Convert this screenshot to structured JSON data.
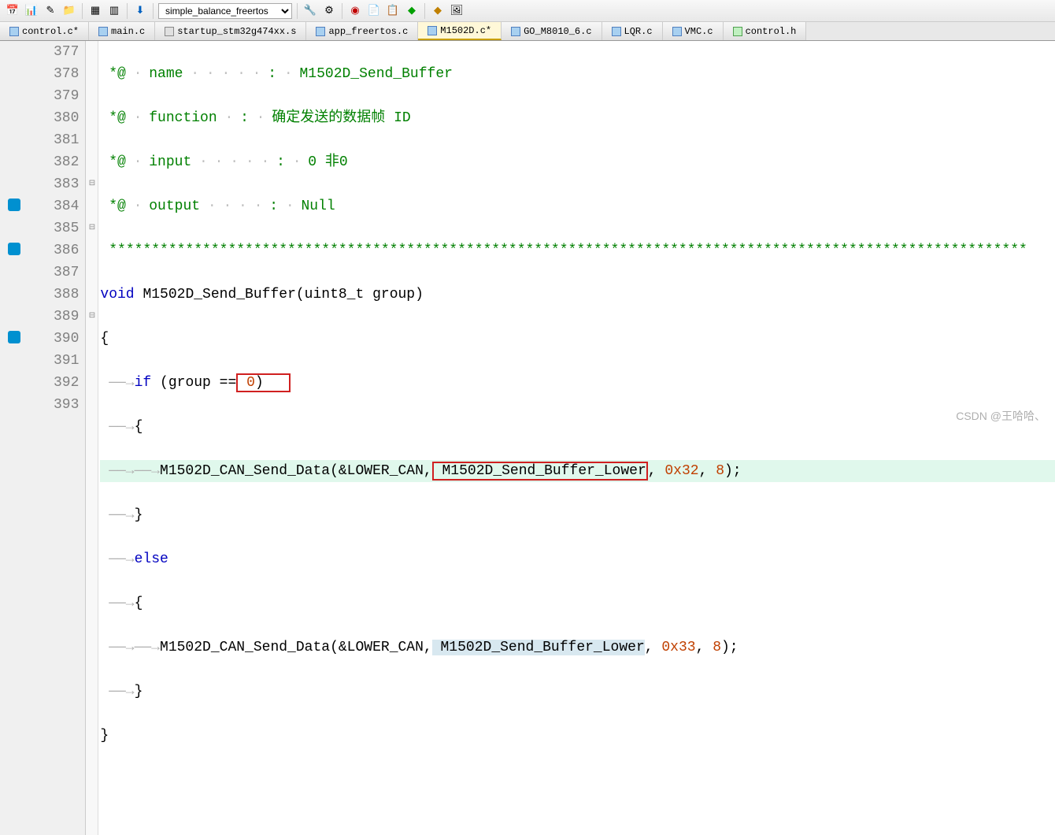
{
  "toolbar": {
    "combo_value": "simple_balance_freertos"
  },
  "tabs": [
    {
      "label": "control.c*",
      "type": "c",
      "active": false
    },
    {
      "label": "main.c",
      "type": "c",
      "active": false
    },
    {
      "label": "startup_stm32g474xx.s",
      "type": "s",
      "active": false
    },
    {
      "label": "app_freertos.c",
      "type": "c",
      "active": false
    },
    {
      "label": "M1502D.c*",
      "type": "c",
      "active": true
    },
    {
      "label": "GO_M8010_6.c",
      "type": "c",
      "active": false
    },
    {
      "label": "LQR.c",
      "type": "c",
      "active": false
    },
    {
      "label": "VMC.c",
      "type": "c",
      "active": false
    },
    {
      "label": "control.h",
      "type": "h",
      "active": false
    }
  ],
  "lines": {
    "start": 377,
    "end": 393
  },
  "code": {
    "c377": {
      "star": "*@",
      "key": "name",
      "val": "M1502D_Send_Buffer"
    },
    "c378": {
      "star": "*@",
      "key": "function",
      "val": "确定发送的数据帧 ID"
    },
    "c379": {
      "star": "*@",
      "key": "input",
      "val": "0 非0"
    },
    "c380": {
      "star": "*@",
      "key": "output",
      "val": "Null"
    },
    "c381": {
      "stars": "************************************************************************************************************"
    },
    "c382": {
      "kw": "void",
      "fn": "M1502D_Send_Buffer",
      "params": "(uint8_t group)"
    },
    "c383": {
      "brace": "{"
    },
    "c384": {
      "kw": "if",
      "cond1": " (group ==",
      "zero": " 0",
      "cond2": ")"
    },
    "c385": {
      "brace": "{"
    },
    "c386": {
      "fn": "M1502D_CAN_Send_Data",
      "amp": "(&LOWER_CAN,",
      "buf": " M1502D_Send_Buffer_Lower",
      "comma1": ",",
      "hex": " 0x32",
      "comma2": ",",
      "num": " 8",
      "end": ");"
    },
    "c387": {
      "brace": "}"
    },
    "c388": {
      "kw": "else"
    },
    "c389": {
      "brace": "{"
    },
    "c390": {
      "fn": "M1502D_CAN_Send_Data",
      "amp": "(&LOWER_CAN,",
      "buf": " M1502D_Send_Buffer_Lower",
      "comma1": ",",
      "hex": " 0x33",
      "comma2": ",",
      "num": " 8",
      "end": ");"
    },
    "c391": {
      "brace": "}"
    },
    "c392": {
      "brace": "}"
    }
  },
  "fold": {
    "383": "⊟",
    "385": "⊟",
    "389": "⊟"
  },
  "watermark": "CSDN @王哈哈、"
}
